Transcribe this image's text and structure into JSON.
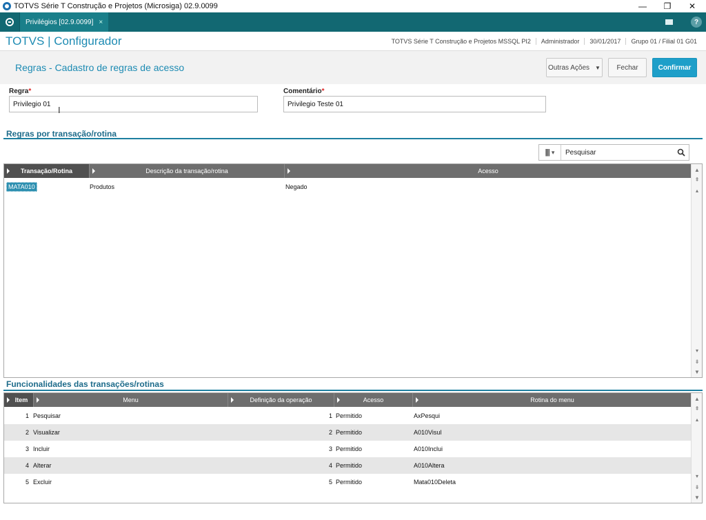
{
  "window": {
    "title": "TOTVS Série T Construção e Projetos (Microsiga) 02.9.0099",
    "minimize": "—",
    "restore": "❐",
    "close": "✕"
  },
  "tabbar": {
    "tab_label": "Privilégios [02.9.0099]",
    "tab_close": "×",
    "help": "?"
  },
  "header": {
    "brand": "TOTVS | Configurador",
    "info": [
      "TOTVS Série T Construção e Projetos MSSQL PI2",
      "Administrador",
      "30/01/2017",
      "Grupo 01 / Filial 01 G01"
    ]
  },
  "page": {
    "title": "Regras - Cadastro de regras de acesso",
    "buttons": {
      "outras_acoes": "Outras Ações",
      "fechar": "Fechar",
      "confirmar": "Confirmar"
    }
  },
  "form": {
    "regra_label": "Regra",
    "regra_value": "Privilegio 01",
    "comentario_label": "Comentário",
    "comentario_value": "Privilegio Teste 01",
    "required_mark": "*"
  },
  "rules_section": {
    "title": "Regras por transação/rotina",
    "search_text": "Pesquisar",
    "columns": [
      "Transação/Rotina",
      "Descrição da transação/rotina",
      "Acesso"
    ],
    "rows": [
      {
        "transacao": "MATA010",
        "descricao": "Produtos",
        "acesso": "Negado"
      }
    ]
  },
  "func_section": {
    "title": "Funcionalidades das transações/rotinas",
    "columns": [
      "Item",
      "Menu",
      "Definição da operação",
      "Acesso",
      "Rotina do menu"
    ],
    "rows": [
      {
        "item": "1",
        "menu": "Pesquisar",
        "definicao": "1",
        "acesso": "Permitido",
        "rotina": "AxPesqui"
      },
      {
        "item": "2",
        "menu": "Visualizar",
        "definicao": "2",
        "acesso": "Permitido",
        "rotina": "A010Visul"
      },
      {
        "item": "3",
        "menu": "Incluir",
        "definicao": "3",
        "acesso": "Permitido",
        "rotina": "A010Inclui"
      },
      {
        "item": "4",
        "menu": "Alterar",
        "definicao": "4",
        "acesso": "Permitido",
        "rotina": "A010Altera"
      },
      {
        "item": "5",
        "menu": "Excluir",
        "definicao": "5",
        "acesso": "Permitido",
        "rotina": "Mata010Deleta"
      }
    ]
  },
  "colors": {
    "tabbar": "#126872",
    "brand": "#1d8bb3",
    "primary_button": "#1e9fc9",
    "grid_header": "#6e6e6e"
  }
}
